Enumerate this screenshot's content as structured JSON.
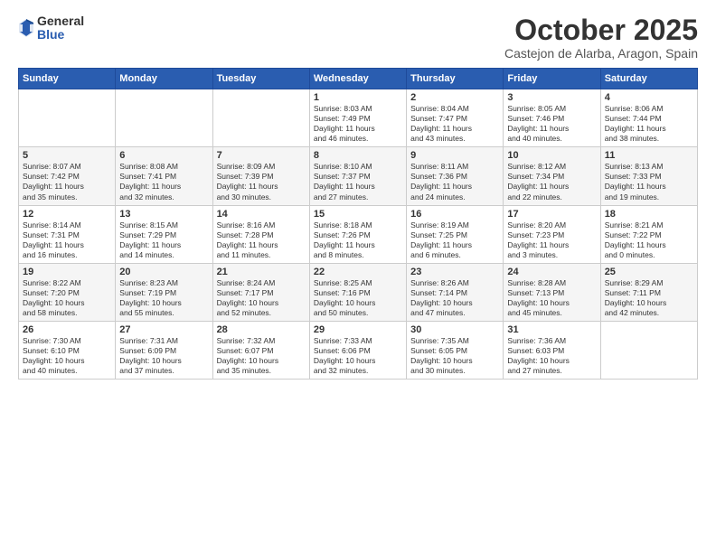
{
  "logo": {
    "general": "General",
    "blue": "Blue"
  },
  "title": "October 2025",
  "subtitle": "Castejon de Alarba, Aragon, Spain",
  "headers": [
    "Sunday",
    "Monday",
    "Tuesday",
    "Wednesday",
    "Thursday",
    "Friday",
    "Saturday"
  ],
  "weeks": [
    [
      {
        "num": "",
        "info": ""
      },
      {
        "num": "",
        "info": ""
      },
      {
        "num": "",
        "info": ""
      },
      {
        "num": "1",
        "info": "Sunrise: 8:03 AM\nSunset: 7:49 PM\nDaylight: 11 hours\nand 46 minutes."
      },
      {
        "num": "2",
        "info": "Sunrise: 8:04 AM\nSunset: 7:47 PM\nDaylight: 11 hours\nand 43 minutes."
      },
      {
        "num": "3",
        "info": "Sunrise: 8:05 AM\nSunset: 7:46 PM\nDaylight: 11 hours\nand 40 minutes."
      },
      {
        "num": "4",
        "info": "Sunrise: 8:06 AM\nSunset: 7:44 PM\nDaylight: 11 hours\nand 38 minutes."
      }
    ],
    [
      {
        "num": "5",
        "info": "Sunrise: 8:07 AM\nSunset: 7:42 PM\nDaylight: 11 hours\nand 35 minutes."
      },
      {
        "num": "6",
        "info": "Sunrise: 8:08 AM\nSunset: 7:41 PM\nDaylight: 11 hours\nand 32 minutes."
      },
      {
        "num": "7",
        "info": "Sunrise: 8:09 AM\nSunset: 7:39 PM\nDaylight: 11 hours\nand 30 minutes."
      },
      {
        "num": "8",
        "info": "Sunrise: 8:10 AM\nSunset: 7:37 PM\nDaylight: 11 hours\nand 27 minutes."
      },
      {
        "num": "9",
        "info": "Sunrise: 8:11 AM\nSunset: 7:36 PM\nDaylight: 11 hours\nand 24 minutes."
      },
      {
        "num": "10",
        "info": "Sunrise: 8:12 AM\nSunset: 7:34 PM\nDaylight: 11 hours\nand 22 minutes."
      },
      {
        "num": "11",
        "info": "Sunrise: 8:13 AM\nSunset: 7:33 PM\nDaylight: 11 hours\nand 19 minutes."
      }
    ],
    [
      {
        "num": "12",
        "info": "Sunrise: 8:14 AM\nSunset: 7:31 PM\nDaylight: 11 hours\nand 16 minutes."
      },
      {
        "num": "13",
        "info": "Sunrise: 8:15 AM\nSunset: 7:29 PM\nDaylight: 11 hours\nand 14 minutes."
      },
      {
        "num": "14",
        "info": "Sunrise: 8:16 AM\nSunset: 7:28 PM\nDaylight: 11 hours\nand 11 minutes."
      },
      {
        "num": "15",
        "info": "Sunrise: 8:18 AM\nSunset: 7:26 PM\nDaylight: 11 hours\nand 8 minutes."
      },
      {
        "num": "16",
        "info": "Sunrise: 8:19 AM\nSunset: 7:25 PM\nDaylight: 11 hours\nand 6 minutes."
      },
      {
        "num": "17",
        "info": "Sunrise: 8:20 AM\nSunset: 7:23 PM\nDaylight: 11 hours\nand 3 minutes."
      },
      {
        "num": "18",
        "info": "Sunrise: 8:21 AM\nSunset: 7:22 PM\nDaylight: 11 hours\nand 0 minutes."
      }
    ],
    [
      {
        "num": "19",
        "info": "Sunrise: 8:22 AM\nSunset: 7:20 PM\nDaylight: 10 hours\nand 58 minutes."
      },
      {
        "num": "20",
        "info": "Sunrise: 8:23 AM\nSunset: 7:19 PM\nDaylight: 10 hours\nand 55 minutes."
      },
      {
        "num": "21",
        "info": "Sunrise: 8:24 AM\nSunset: 7:17 PM\nDaylight: 10 hours\nand 52 minutes."
      },
      {
        "num": "22",
        "info": "Sunrise: 8:25 AM\nSunset: 7:16 PM\nDaylight: 10 hours\nand 50 minutes."
      },
      {
        "num": "23",
        "info": "Sunrise: 8:26 AM\nSunset: 7:14 PM\nDaylight: 10 hours\nand 47 minutes."
      },
      {
        "num": "24",
        "info": "Sunrise: 8:28 AM\nSunset: 7:13 PM\nDaylight: 10 hours\nand 45 minutes."
      },
      {
        "num": "25",
        "info": "Sunrise: 8:29 AM\nSunset: 7:11 PM\nDaylight: 10 hours\nand 42 minutes."
      }
    ],
    [
      {
        "num": "26",
        "info": "Sunrise: 7:30 AM\nSunset: 6:10 PM\nDaylight: 10 hours\nand 40 minutes."
      },
      {
        "num": "27",
        "info": "Sunrise: 7:31 AM\nSunset: 6:09 PM\nDaylight: 10 hours\nand 37 minutes."
      },
      {
        "num": "28",
        "info": "Sunrise: 7:32 AM\nSunset: 6:07 PM\nDaylight: 10 hours\nand 35 minutes."
      },
      {
        "num": "29",
        "info": "Sunrise: 7:33 AM\nSunset: 6:06 PM\nDaylight: 10 hours\nand 32 minutes."
      },
      {
        "num": "30",
        "info": "Sunrise: 7:35 AM\nSunset: 6:05 PM\nDaylight: 10 hours\nand 30 minutes."
      },
      {
        "num": "31",
        "info": "Sunrise: 7:36 AM\nSunset: 6:03 PM\nDaylight: 10 hours\nand 27 minutes."
      },
      {
        "num": "",
        "info": ""
      }
    ]
  ]
}
